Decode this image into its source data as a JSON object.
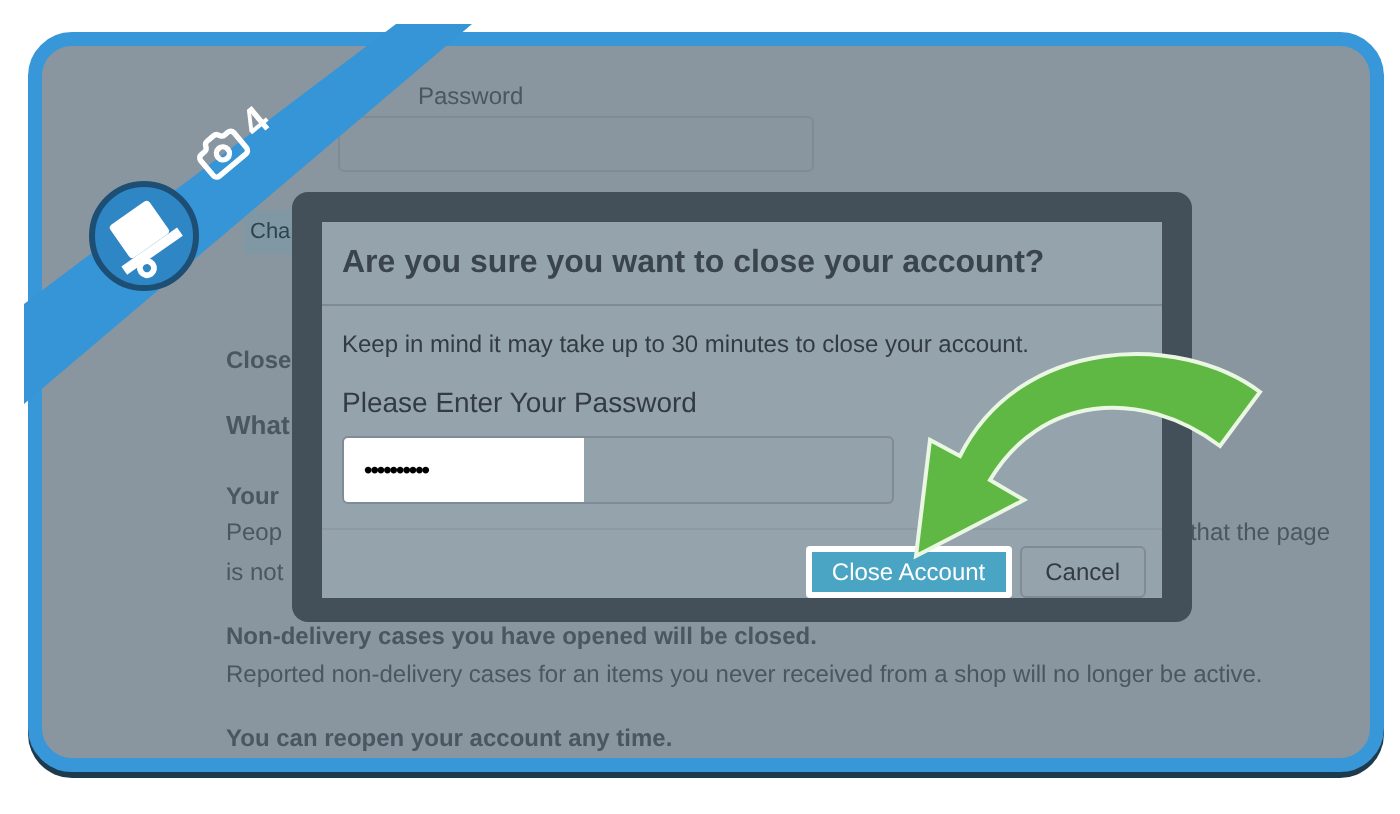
{
  "background": {
    "password_label": "Password",
    "change_button": "Cha",
    "section_title": "Close",
    "section_heading": "What",
    "notice_title": "Your",
    "notice_text": "Peop",
    "notice_text_right": "that the page",
    "notice_text_end": "is not",
    "items": [
      {
        "title": "Non-delivery cases you have opened will be closed.",
        "text": "Reported non-delivery cases for an items you never received from a shop will no longer be active."
      },
      {
        "title": "You can reopen your account any time."
      }
    ]
  },
  "dialog": {
    "title": "Are you sure you want to close your account?",
    "message": "Keep in mind it may take up to 30 minutes to close your account.",
    "password_label": "Please Enter Your Password",
    "password_value": "••••••••••",
    "buttons": [
      {
        "label": "Close Account",
        "kind": "primary"
      },
      {
        "label": "Cancel",
        "kind": "secondary"
      }
    ]
  },
  "step": {
    "number": "4"
  }
}
